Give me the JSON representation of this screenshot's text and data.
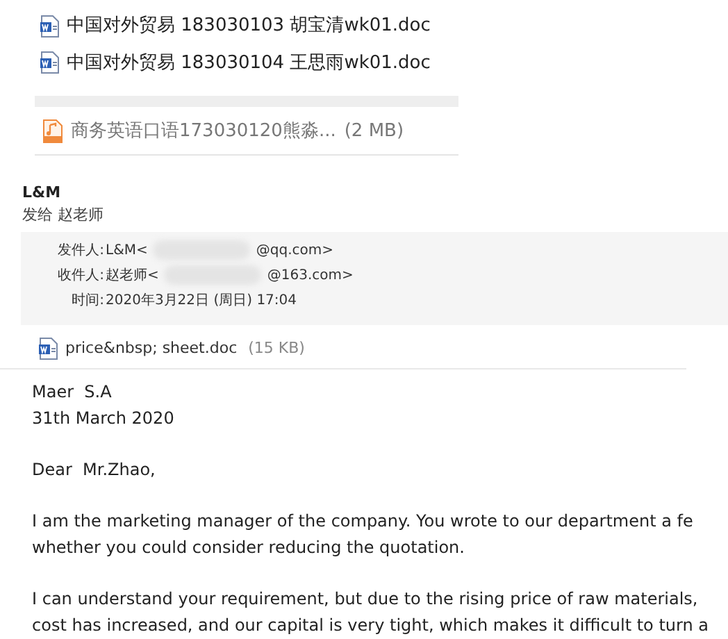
{
  "files": [
    {
      "name": "中国对外贸易 183030103 胡宝清wk01.doc",
      "kind": "doc"
    },
    {
      "name": "中国对外贸易 183030104 王思雨wk01.doc",
      "kind": "doc"
    }
  ],
  "attachment": {
    "name": "商务英语口语173030120熊淼...",
    "size": "(2 MB)",
    "kind": "audio"
  },
  "email": {
    "sender": "L&M",
    "to_line": "发给 赵老师",
    "header": [
      {
        "label": "发件人:",
        "before": "L&M<",
        "after": "@qq.com>"
      },
      {
        "label": "收件人:",
        "before": "赵老师<",
        "after": "@163.com>"
      },
      {
        "label": "时间:",
        "before": "2020年3月22日 (周日) 17:04"
      }
    ],
    "attachment": {
      "name": "price&nbsp; sheet.doc",
      "size": "(15 KB)"
    },
    "paragraphs": [
      [
        "Maer  S.A",
        "31th March 2020"
      ],
      [
        "Dear  Mr.Zhao,"
      ],
      [
        "I am the marketing manager of the company. You wrote to our department a fe",
        "whether you could consider reducing the quotation."
      ],
      [
        "I can understand your requirement, but due to the rising price of raw materials,",
        "cost has increased, and our capital is very tight, which makes it difficult to turn a"
      ]
    ]
  }
}
